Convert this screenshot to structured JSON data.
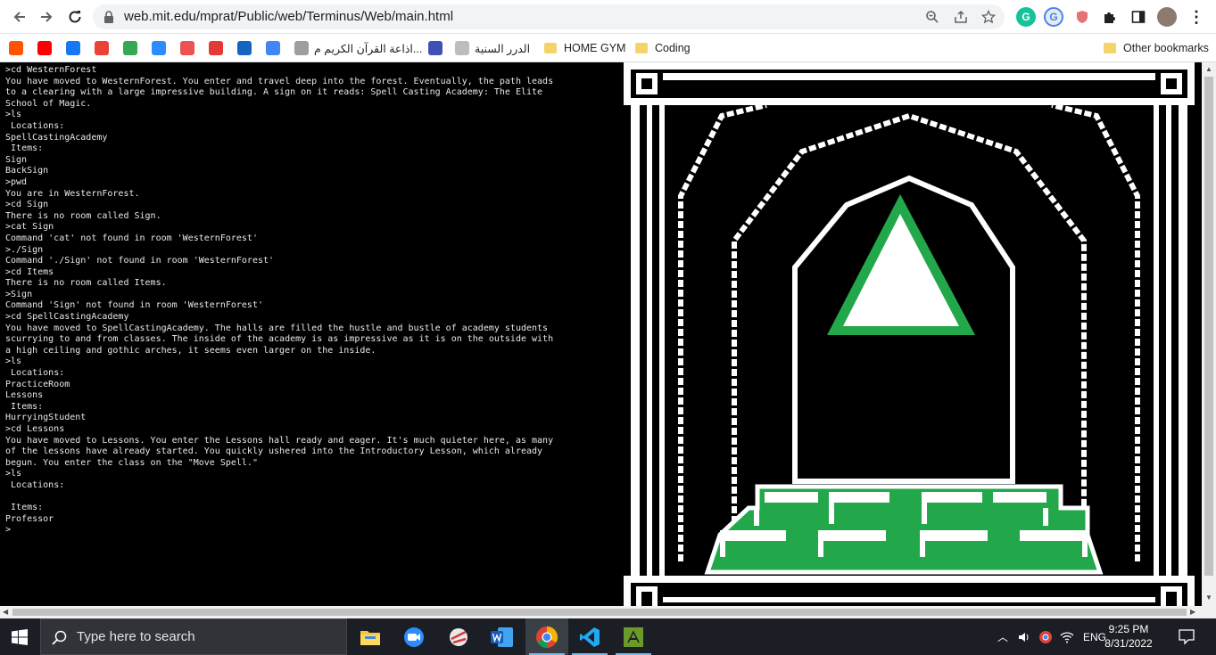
{
  "browser": {
    "url": "web.mit.edu/mprat/Public/web/Terminus/Web/main.html",
    "nav": {
      "back_icon": "arrow-left-icon",
      "forward_icon": "arrow-right-icon",
      "reload_icon": "reload-icon"
    }
  },
  "bookmarks": [
    {
      "label": "",
      "icon": "soundcloud-icon",
      "color": "#ff5500"
    },
    {
      "label": "",
      "icon": "youtube-icon",
      "color": "#ff0000"
    },
    {
      "label": "",
      "icon": "facebook-icon",
      "color": "#1877f2"
    },
    {
      "label": "",
      "icon": "gmail-icon",
      "color": "#ea4335"
    },
    {
      "label": "",
      "icon": "google-drive-icon",
      "color": "#34a853"
    },
    {
      "label": "",
      "icon": "zoom-icon",
      "color": "#2d8cff"
    },
    {
      "label": "",
      "icon": "udemy-icon",
      "color": "#ec5252"
    },
    {
      "label": "",
      "icon": "pd-icon",
      "color": "#e53935"
    },
    {
      "label": "",
      "icon": "e-icon",
      "color": "#1565c0"
    },
    {
      "label": "",
      "icon": "google-translate-icon",
      "color": "#4285f4"
    },
    {
      "label": "اذاعة القرآن الكريم م...",
      "icon": "radio-icon",
      "color": "#9e9e9e"
    },
    {
      "label": "",
      "icon": "m-logo-icon",
      "color": "#3f51b5"
    },
    {
      "label": "الدرر السنية",
      "icon": "page-icon",
      "color": "#bdbdbd"
    },
    {
      "label": "HOME GYM",
      "icon": "folder-icon",
      "color": "#f4d36b"
    },
    {
      "label": "Coding",
      "icon": "folder-icon",
      "color": "#f4d36b"
    },
    {
      "label": "Other bookmarks",
      "icon": "folder-icon",
      "color": "#f4d36b"
    }
  ],
  "terminal": {
    "lines": [
      ">cd WesternForest",
      "You have moved to WesternForest. You enter and travel deep into the forest. Eventually, the path leads to a clearing with a large impressive building. A sign on it reads: Spell Casting Academy: The Elite School of Magic.",
      ">ls",
      " Locations:",
      "SpellCastingAcademy",
      " Items:",
      "Sign",
      "BackSign",
      ">pwd",
      "You are in WesternForest.",
      ">cd Sign",
      "There is no room called Sign.",
      ">cat Sign",
      "Command 'cat' not found in room 'WesternForest'",
      ">./Sign",
      "Command './Sign' not found in room 'WesternForest'",
      ">cd Items",
      "There is no room called Items.",
      ">Sign",
      "Command 'Sign' not found in room 'WesternForest'",
      ">cd SpellCastingAcademy",
      "You have moved to SpellCastingAcademy. The halls are filled the hustle and bustle of academy students scurrying to and from classes. The inside of the academy is as impressive as it is on the outside with a high ceiling and gothic arches, it seems even larger on the inside.",
      ">ls",
      " Locations:",
      "PracticeRoom",
      "Lessons",
      " Items:",
      "HurryingStudent",
      ">cd Lessons",
      "You have moved to Lessons. You enter the Lessons hall ready and eager. It's much quieter here, as many of the lessons have already started. You quickly ushered into the Introductory Lesson, which already begun. You enter the class on the \"Move Spell.\"",
      ">ls",
      " Locations:",
      " ",
      " Items:",
      "Professor",
      ">"
    ]
  },
  "art": {
    "accent_green": "#22a84a",
    "outline": "#ffffff",
    "background": "#000000"
  },
  "taskbar": {
    "search_placeholder": "Type here to search",
    "apps": [
      {
        "name": "file-explorer-icon",
        "active": false
      },
      {
        "name": "zoom-icon",
        "active": false
      },
      {
        "name": "snipping-tool-icon",
        "active": false
      },
      {
        "name": "word-icon",
        "active": false
      },
      {
        "name": "chrome-icon",
        "active": true
      },
      {
        "name": "vscode-icon",
        "active": false
      },
      {
        "name": "terminal-app-icon",
        "active": false
      }
    ],
    "language": "ENG",
    "time": "9:25 PM",
    "date": "8/31/2022"
  }
}
